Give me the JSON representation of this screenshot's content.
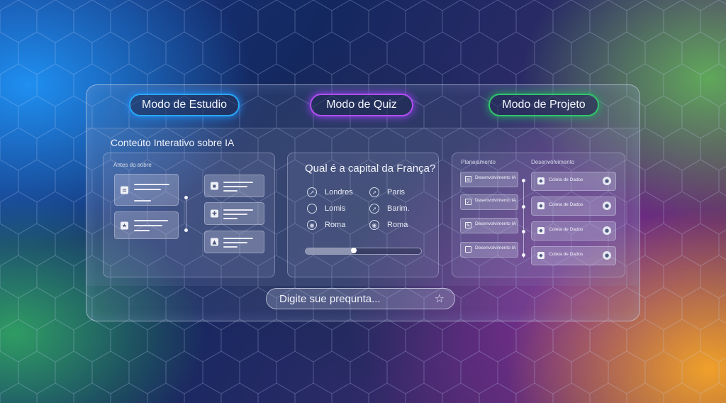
{
  "modes": {
    "study": "Modo de Estudio",
    "quiz": "Modo de Quiz",
    "project": "Modo de Projeto"
  },
  "content_title": "Conteúto Interativo sobre IA",
  "study_card": {
    "label": "Antes do sobre",
    "left_icons": [
      "note-icon",
      "star-icon"
    ],
    "right_icons": [
      "image-icon",
      "puzzle-icon",
      "chat-icon"
    ]
  },
  "quiz": {
    "question": "Qual é a capital da França?",
    "options": [
      {
        "label": "Londres",
        "icon": "cursor-icon"
      },
      {
        "label": "Paris",
        "icon": "cursor-icon"
      },
      {
        "label": "Lomis",
        "icon": "empty"
      },
      {
        "label": "Barim.",
        "icon": "cursor-icon"
      },
      {
        "label": "Roma",
        "icon": "target-icon"
      },
      {
        "label": "Roma",
        "icon": "target-icon"
      }
    ],
    "progress": 0.42
  },
  "project_card": {
    "planning_label": "Planejamento",
    "dev_label": "Desenvolvimento",
    "planning_items": [
      "Desenvolvimento IA",
      "Desenvolvimento IA",
      "Desenvolvimento IA",
      "Desenvolvimento IA"
    ],
    "dev_items": [
      "Coleta de Dados",
      "Coleta de Dados",
      "Coleta de Dados",
      "Coleta de Dados"
    ]
  },
  "ask": {
    "placeholder": "Digite sue prequnta...",
    "icon": "star-icon"
  },
  "colors": {
    "study": "#2aa7f5",
    "quiz": "#b04ff0",
    "project": "#33c46d"
  }
}
